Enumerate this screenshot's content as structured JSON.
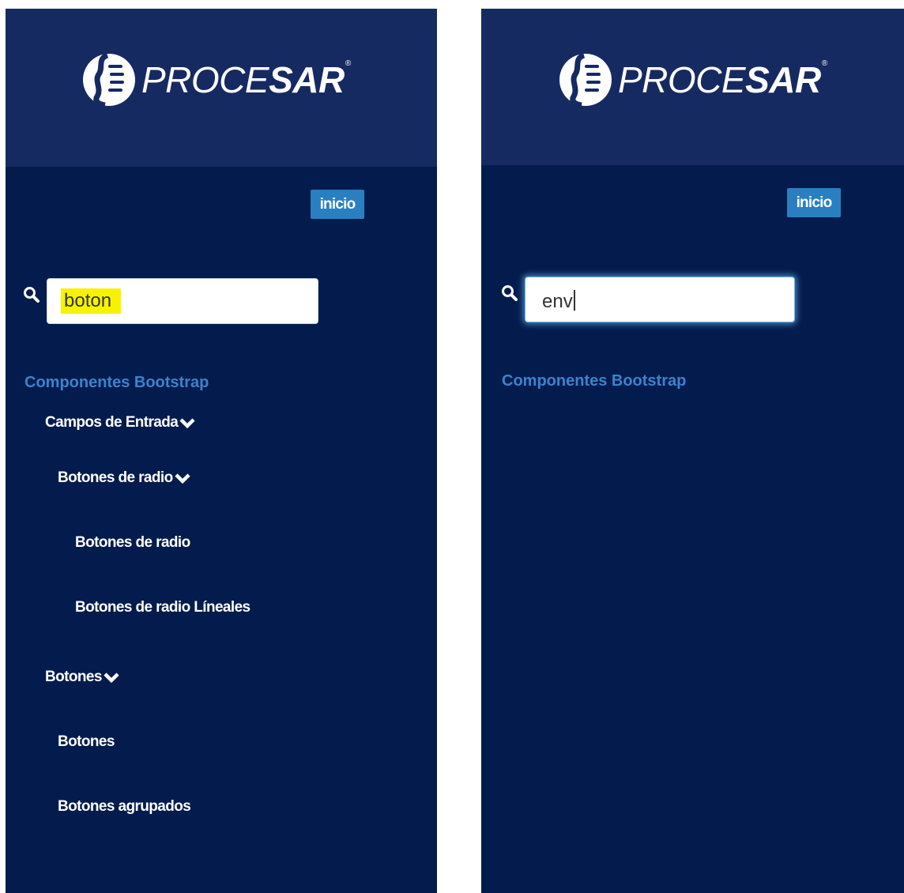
{
  "brand": {
    "name_thin": "PROCE",
    "name_bold": "SAR",
    "registered": "®"
  },
  "colors": {
    "panel_bg": "#041c4d",
    "header_bg": "#162a62",
    "accent_blue": "#2a7fc1",
    "section_title": "#3c82cb",
    "search_highlight": "#f7f300"
  },
  "panels": [
    {
      "inicio_label": "inicio",
      "search_value": "boton",
      "search_value_highlighted": true,
      "section_title": "Componentes Bootstrap",
      "tree": [
        {
          "label": "Campos de Entrada",
          "level": 1,
          "expanded": true,
          "icon": "chevron-down-icon"
        },
        {
          "label": "Botones de radio",
          "level": 2,
          "expanded": true,
          "icon": "chevron-down-icon"
        },
        {
          "label": "Botones de radio",
          "level": 3
        },
        {
          "label": "Botones de radio Líneales",
          "level": 3
        },
        {
          "label": "Botones",
          "level": 1,
          "expanded": true,
          "icon": "chevron-down-icon"
        },
        {
          "label": "Botones",
          "level": 2
        },
        {
          "label": "Botones agrupados",
          "level": 2
        }
      ]
    },
    {
      "inicio_label": "inicio",
      "search_value": "env",
      "search_focused": true,
      "section_title": "Componentes Bootstrap",
      "tree": []
    }
  ]
}
